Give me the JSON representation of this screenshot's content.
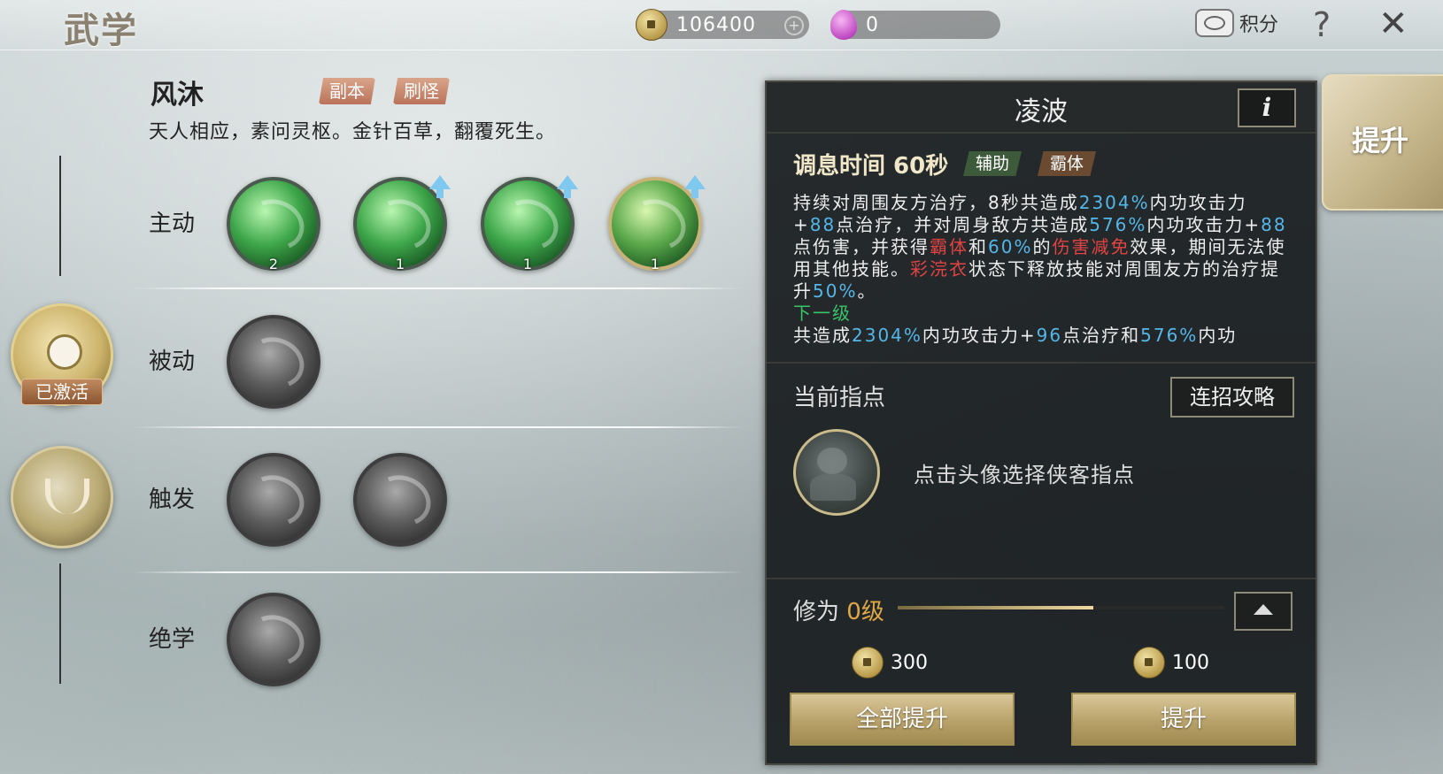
{
  "header": {
    "title": "武学",
    "coins": "106400",
    "gems": "0",
    "score_label": "积分",
    "help_label": "?",
    "close_label": "✕"
  },
  "sect": {
    "name": "风沐",
    "tags": [
      "副本",
      "刷怪"
    ],
    "description": "天人相应，素问灵枢。金针百草，翻覆死生。"
  },
  "rows": {
    "active": {
      "label": "主动",
      "levels": [
        "2",
        "1",
        "1",
        "1"
      ]
    },
    "passive": {
      "label": "被动"
    },
    "trigger": {
      "label": "触发"
    },
    "ultimate": {
      "label": "绝学"
    }
  },
  "side": {
    "activated_label": "已激活"
  },
  "panel": {
    "skill_name": "凌波",
    "info_label": "i",
    "cooldown": "调息时间 60秒",
    "tags": [
      "辅助",
      "霸体"
    ],
    "desc": {
      "p1": "持续对周围友方治疗，8秒共造成",
      "v1": "2304%",
      "p2": "内功攻击力+",
      "v2": "88",
      "p3": "点治疗，并对周身敌方共造成",
      "v3": "576%",
      "p4": "内功攻击力+",
      "v4": "88",
      "p5": "点伤害，并获得",
      "r1": "霸体",
      "p6": "和",
      "v5": "60%",
      "p7": "的",
      "r2": "伤害减免",
      "p8": "效果，期间无法使用其他技能。",
      "r3": "彩浣衣",
      "p9": "状态下释放技能对周围友方的治疗提升",
      "v6": "50%",
      "p10": "。",
      "next_label": "下一级",
      "n1": "共造成",
      "nv1": "2304%",
      "n2": "内功攻击力+",
      "nv2": "96",
      "n3": "点治疗和",
      "nv3": "576%",
      "n4": "内功"
    },
    "guide_label": "当前指点",
    "combo_button": "连招攻略",
    "avatar_hint": "点击头像选择侠客指点",
    "cultivation_label": "修为",
    "cultivation_level": "0级",
    "cultivation_progress": 0.6,
    "cost_all": "300",
    "cost_one": "100",
    "upgrade_all": "全部提升",
    "upgrade_one": "提升"
  },
  "side_tab": {
    "label": "提升"
  },
  "colors": {
    "accent_blue": "#55b6e8",
    "accent_red": "#e04444",
    "accent_green": "#39c46a",
    "gold": "#e0a845"
  }
}
